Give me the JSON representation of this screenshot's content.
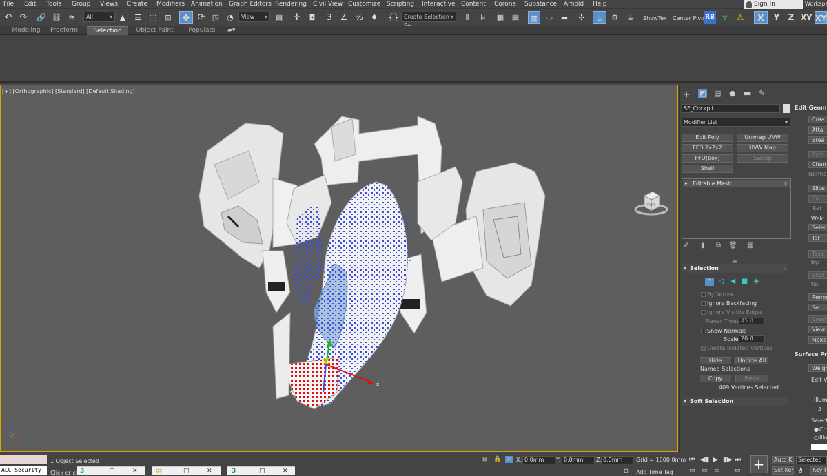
{
  "menu": [
    "File",
    "Edit",
    "Tools",
    "Group",
    "Views",
    "Create",
    "Modifiers",
    "Animation",
    "Graph Editors",
    "Rendering",
    "Civil View",
    "Customize",
    "Scripting",
    "Interactive",
    "Content",
    "Corona",
    "Substance",
    "Arnold",
    "Help"
  ],
  "account": {
    "sign_in": "Sign In",
    "workspace": "Workspac"
  },
  "toolbar": {
    "filter_value": "All",
    "view_value": "View",
    "selection_set_placeholder": "Create Selection Se",
    "show_tex": "ShowTex",
    "center_pivot": "Center Pivot",
    "rb": "RB",
    "x": "X",
    "y": "Y",
    "z": "Z",
    "xy": "XY",
    "xy2": "XY"
  },
  "ribbon_tabs": [
    {
      "label": "Modeling",
      "active": false
    },
    {
      "label": "Freeform",
      "active": false
    },
    {
      "label": "Selection",
      "active": true
    },
    {
      "label": "Object Paint",
      "active": false
    },
    {
      "label": "Populate",
      "active": false
    }
  ],
  "viewport": {
    "label": "[+] [Orthographic] [Standard] [Default Shading]",
    "viewcube_label": "FRONT"
  },
  "command_panel": {
    "object_name": "SF_Cockpit",
    "modifier_list": "Modifier List",
    "modifier_buttons": [
      {
        "label": "Edit Poly",
        "enabled": true
      },
      {
        "label": "Unwrap UVW",
        "enabled": true
      },
      {
        "label": "FFD 2x2x2",
        "enabled": true
      },
      {
        "label": "UVW Map",
        "enabled": true
      },
      {
        "label": "FFD(box)",
        "enabled": true
      },
      {
        "label": "Sweep",
        "enabled": false
      },
      {
        "label": "Shell",
        "enabled": true
      }
    ],
    "stack_item": "Editable Mesh",
    "selection": {
      "title": "Selection",
      "by_vertex": "By Vertex",
      "ignore_backfacing": "Ignore Backfacing",
      "ignore_visible_edges": "Ignore Visible Edges",
      "planar_thresh_label": "Planar Thresh:",
      "planar_thresh_value": "45.0",
      "show_normals": "Show Normals",
      "scale_label": "Scale:",
      "scale_value": "20.0",
      "delete_isolated": "Delete Isolated Vertices",
      "hide": "Hide",
      "unhide_all": "Unhide All",
      "named_selections": "Named Selections:",
      "copy": "Copy",
      "paste": "Paste",
      "status": "409 Vertices Selected"
    },
    "soft_selection": "Soft Selection"
  },
  "edit_geometry": {
    "title": "Edit Geom",
    "items": [
      "Crea",
      "Atta",
      "Brea",
      "Extr",
      "Chan",
      "Normal",
      "Slice",
      "Cu",
      "Ref",
      "Weld",
      "Selec",
      "Tar",
      "Tess",
      "by:",
      "Expl",
      "to:",
      "Remo",
      "Se",
      "Creat",
      "View",
      "Make P"
    ],
    "surface_title": "Surface Pr",
    "surface_items": [
      "Weigh",
      "Edit Ve",
      "Illumi",
      "A",
      "Select V",
      "Col",
      "Illu"
    ]
  },
  "status": {
    "selected": "1 Object Selected",
    "prompt": "Click or click",
    "x_label": "X:",
    "x_value": "0.0mm",
    "y_label": "Y:",
    "y_value": "0.0mm",
    "z_label": "Z:",
    "z_value": "0.0mm",
    "grid": "Grid = 1000.0mm",
    "add_time_tag": "Add Time Tag",
    "auto_key": "Auto K",
    "set_key": "Set Key",
    "selected_dropdown": "Selected",
    "key_filters": "Key F"
  },
  "maxscript": {
    "text": "ALC Security"
  },
  "taskbar": [
    {
      "icon": "3"
    },
    {
      "icon": "☺"
    },
    {
      "icon": "3"
    }
  ],
  "colors": {
    "accent": "#5b8fc7",
    "viewport_border": "#d8a300",
    "selection_vertex": "#3b4fd8",
    "selected_vertex": "#e01010"
  }
}
